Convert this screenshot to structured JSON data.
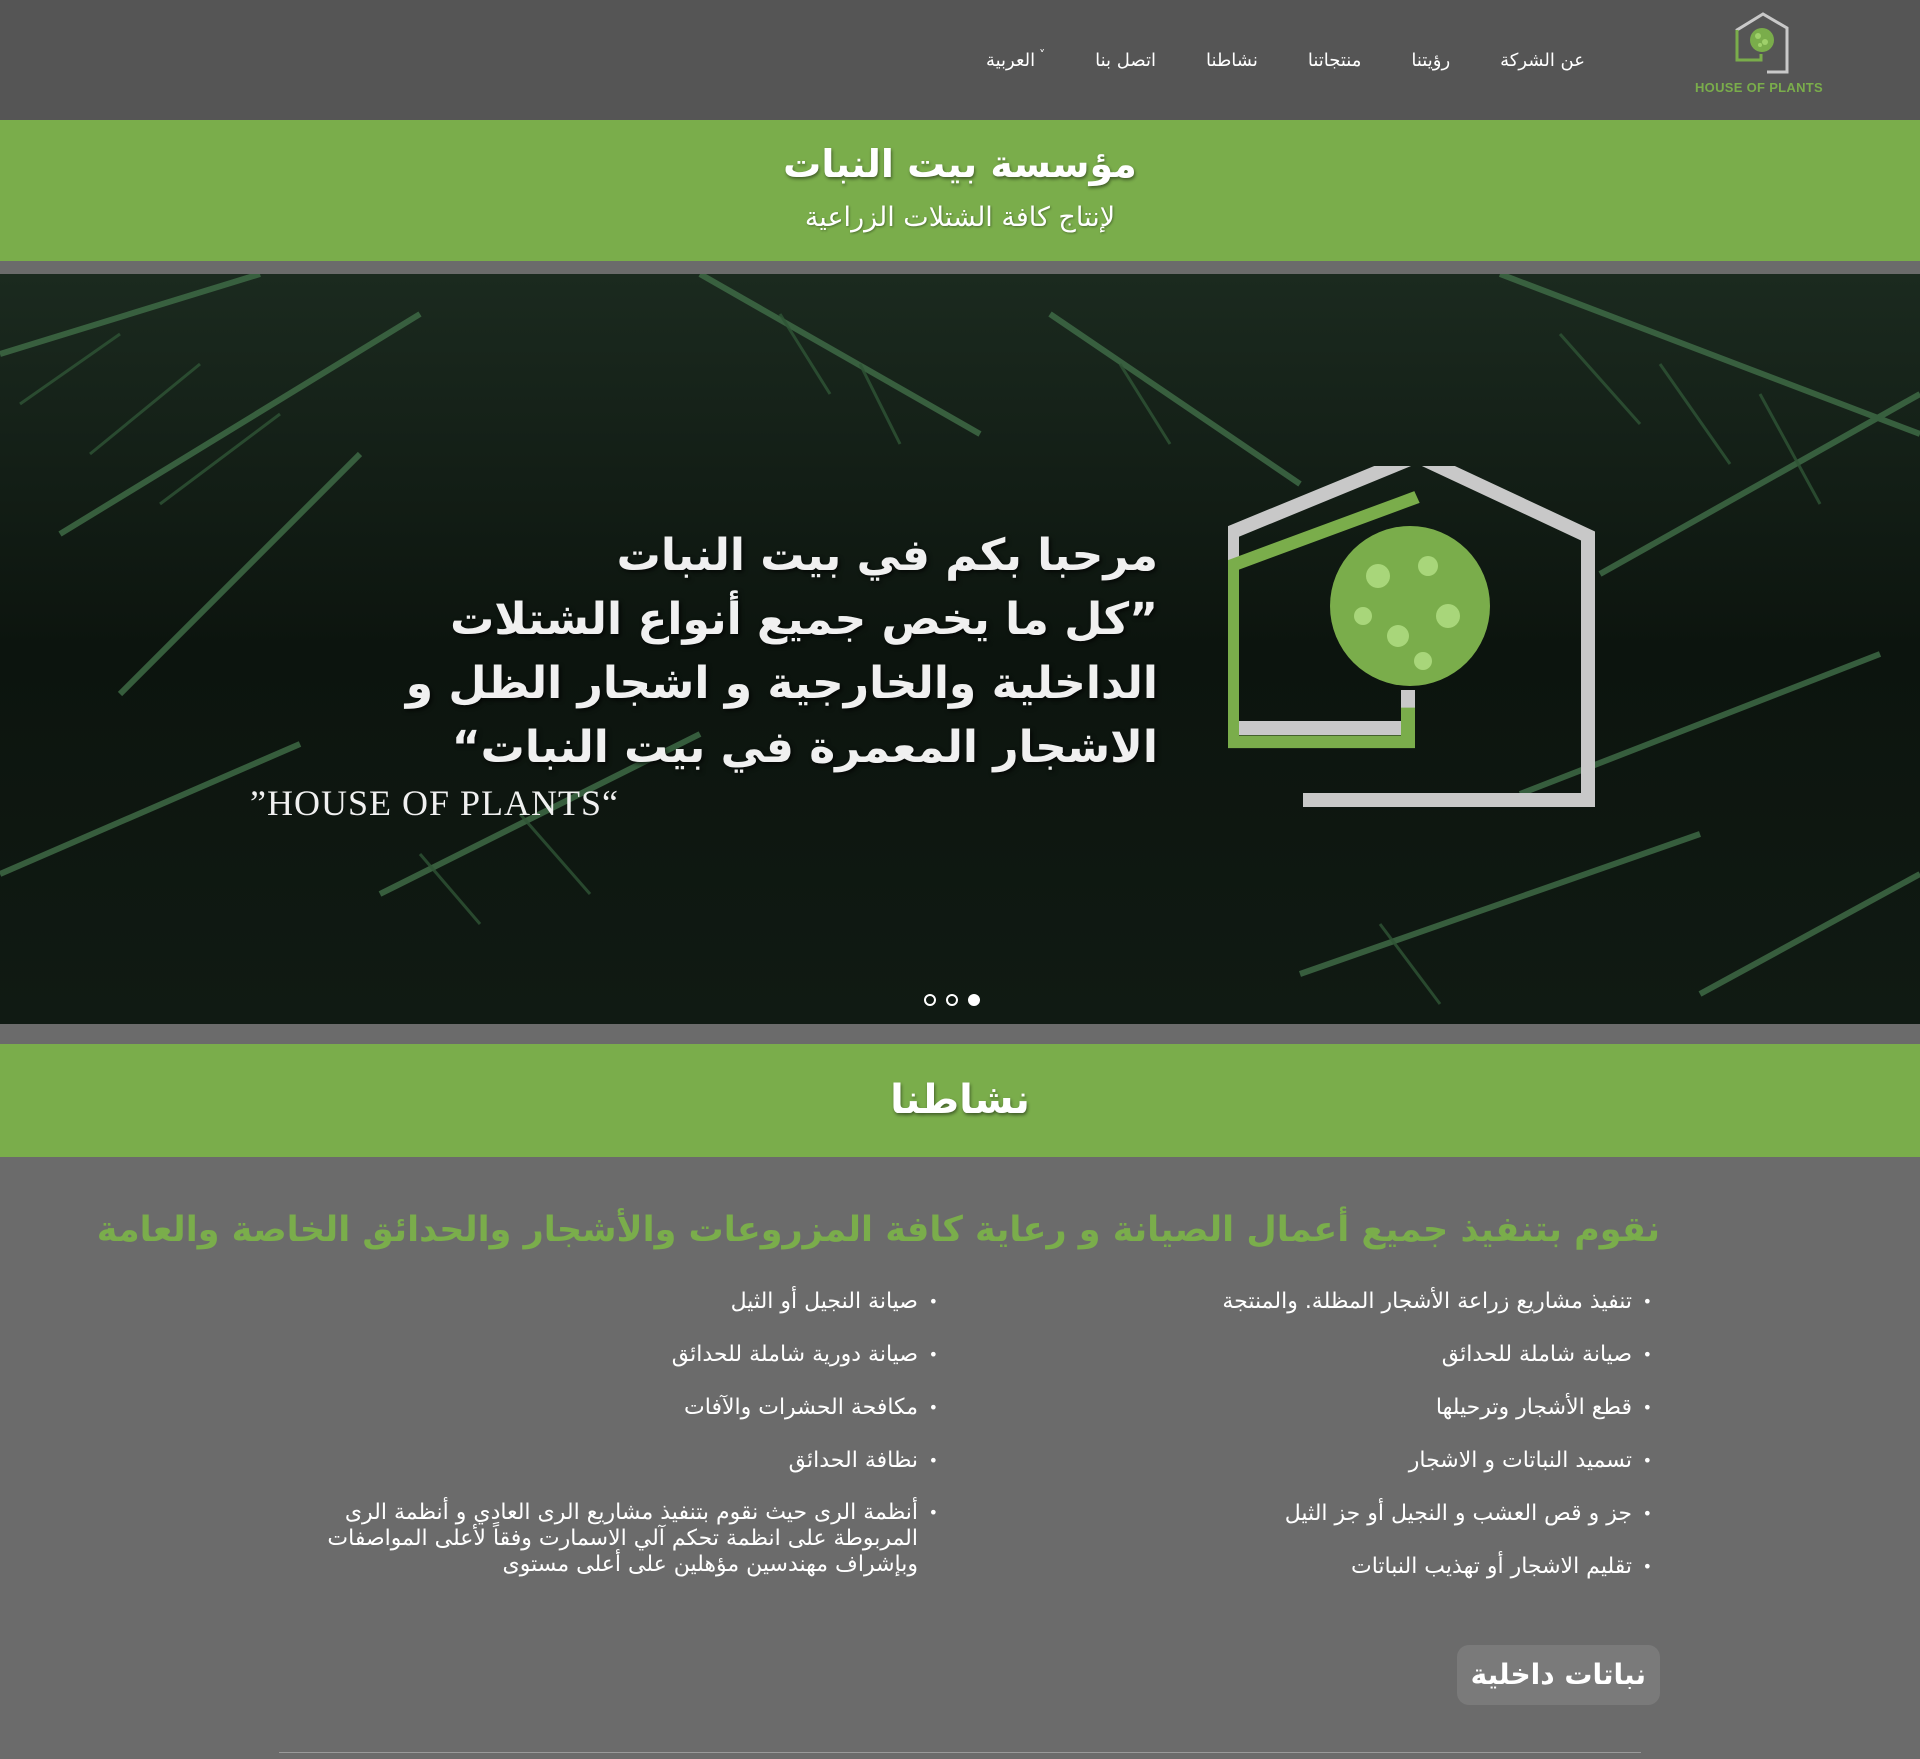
{
  "nav": {
    "logo_text": "HOUSE OF PLANTS",
    "items": [
      "عن الشركة",
      "رؤيتنا",
      "منتجاتنا",
      "نشاطنا",
      "اتصل بنا"
    ],
    "language": "العربية"
  },
  "header": {
    "title": "مؤسسة بيت النبات",
    "subtitle": "لإنتاج كافة الشتلات الزراعية"
  },
  "hero": {
    "lines": [
      "مرحبا بكم في بيت النبات",
      "”كل ما يخص جميع أنواع الشتلات",
      "الداخلية والخارجية و اشجار الظل و",
      "الاشجار المعمرة في بيت النبات“"
    ],
    "brand": "”HOUSE OF PLANTS“",
    "slides": 3,
    "active_slide": 3
  },
  "activities": {
    "title": "نشاطنا",
    "heading": "نقوم بتنفيذ جميع أعمال الصيانة و رعاية كافة المزروعات والأشجار والحدائق الخاصة والعامة",
    "right_list": [
      "تنفيذ مشاريع زراعة الأشجار المظلة. والمنتجة",
      "صيانة شاملة للحدائق",
      "قطع الأشجار وترحيلها",
      "تسميد النباتات و الاشجار",
      "جز و قص العشب و النجيل أو جز الثيل",
      "تقليم الاشجار أو تهذيب النباتات"
    ],
    "left_list": [
      "صيانة النجيل أو الثيل",
      "صيانة دورية شاملة للحدائق",
      "مكافحة الحشرات والآفات",
      "نظافة الحدائق",
      "أنظمة الرى حيث نقوم بتنفيذ مشاريع الرى العادي و أنظمة الرى المربوطة على انظمة تحكم آلي الاسمارت وفقاً لأعلى المواصفات وبإشراف مهندسين مؤهلين على أعلى مستوى"
    ],
    "tab_label": "نباتات داخلية"
  },
  "colors": {
    "accent_green": "#7aad4b",
    "navbar": "#555555",
    "page_bg": "#6b6b6b"
  }
}
